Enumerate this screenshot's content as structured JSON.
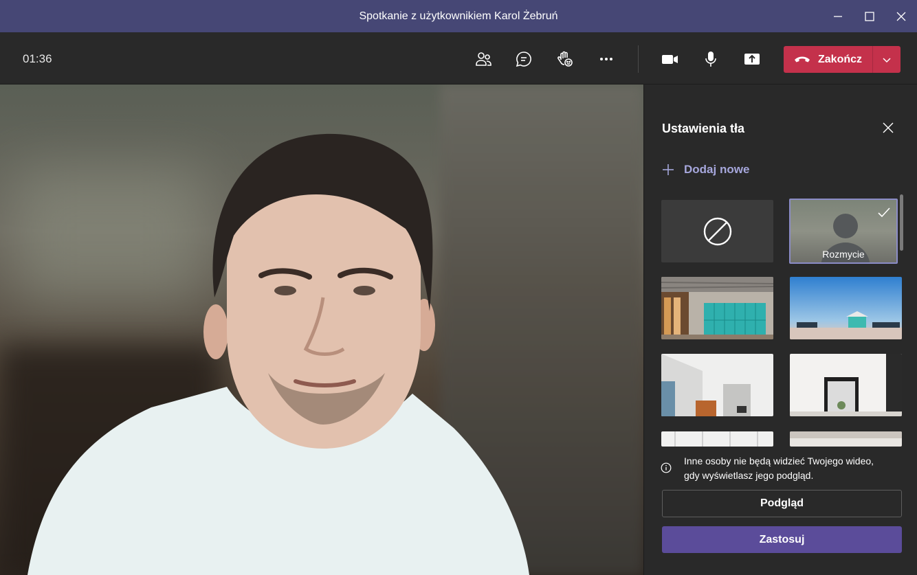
{
  "window": {
    "title": "Spotkanie z użytkownikiem Karol Żebruń",
    "controls": [
      "minimize-icon",
      "maximize-icon",
      "close-icon"
    ]
  },
  "toolbar": {
    "timer": "01:36",
    "icons": [
      "participants-icon",
      "chat-icon",
      "raise-hand-icon",
      "more-options-icon",
      "camera-icon",
      "microphone-icon",
      "share-screen-icon"
    ],
    "end_call_label": "Zakończ",
    "end_call_color": "#c4314b"
  },
  "background_panel": {
    "title": "Ustawienia tła",
    "add_new_label": "Dodaj nowe",
    "options": [
      {
        "kind": "none",
        "label": ""
      },
      {
        "kind": "blur",
        "label": "Rozmycie",
        "selected": true
      },
      {
        "kind": "image",
        "label": "office-lockers"
      },
      {
        "kind": "image",
        "label": "beach-lifeguard-tower"
      },
      {
        "kind": "image",
        "label": "white-room-windows"
      },
      {
        "kind": "image",
        "label": "white-room-mirror"
      },
      {
        "kind": "image",
        "label": "white-room-3"
      },
      {
        "kind": "image",
        "label": "white-room-4"
      }
    ],
    "info_text_line1": "Inne osoby nie będą widzieć Twojego wideo,",
    "info_text_line2": "gdy wyświetlasz jego podgląd.",
    "preview_label": "Podgląd",
    "apply_label": "Zastosuj",
    "accent_color": "#5b4c9a",
    "link_color": "#a6a7dc"
  }
}
